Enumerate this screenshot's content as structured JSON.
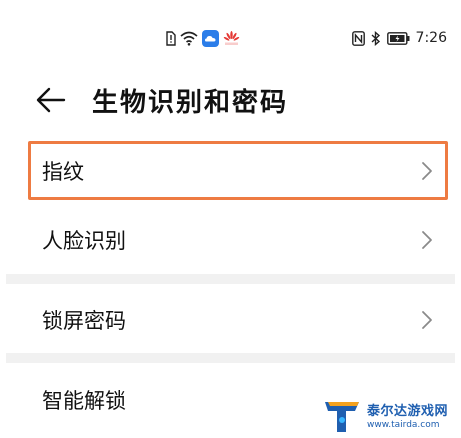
{
  "status_bar": {
    "time": "7:26",
    "huawei_logo_text": "HUAWEI",
    "icons_center": [
      "sim-error-icon",
      "wifi-icon",
      "cloud-icon",
      "huawei-logo-icon"
    ],
    "icons_right": [
      "nfc-icon",
      "bluetooth-icon",
      "battery-icon"
    ]
  },
  "header": {
    "title": "生物识别和密码"
  },
  "rows": {
    "fingerprint": "指纹",
    "face_recognition": "人脸识别",
    "lock_screen_password": "锁屏密码",
    "smart_unlock": "智能解锁"
  },
  "highlight_color": "#ee7b42",
  "watermark": {
    "title": "泰尔达游戏网",
    "url": "www.tairda.com",
    "logo_letter": "T"
  }
}
